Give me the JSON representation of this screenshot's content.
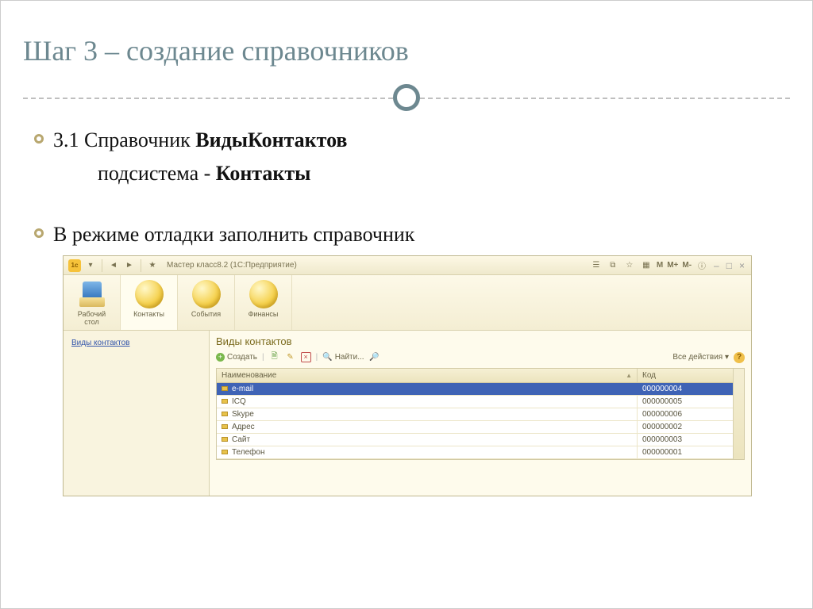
{
  "slide": {
    "title": "Шаг 3 – создание справочников",
    "b1_prefix": "3.1 Справочник  ",
    "b1_bold": "ВидыКонтактов",
    "b2_prefix": "подсистема -  ",
    "b2_bold": "Контакты",
    "b3": "В режиме отладки заполнить  справочник"
  },
  "app": {
    "title": "Мастер класс8.2  (1С:Предприятие)",
    "right_labels": [
      "М",
      "М+",
      "М-"
    ],
    "nav": [
      {
        "label": "Рабочий\nстол"
      },
      {
        "label": "Контакты"
      },
      {
        "label": "События"
      },
      {
        "label": "Финансы"
      }
    ],
    "side_link": "Виды контактов",
    "panel_title": "Виды контактов",
    "toolbar": {
      "create": "Создать",
      "find": "Найти...",
      "actions": "Все действия ▾"
    },
    "grid": {
      "col_name": "Наименование",
      "col_code": "Код",
      "rows": [
        {
          "name": "e-mail",
          "code": "000000004",
          "selected": true
        },
        {
          "name": "ICQ",
          "code": "000000005"
        },
        {
          "name": "Skype",
          "code": "000000006"
        },
        {
          "name": "Адрес",
          "code": "000000002"
        },
        {
          "name": "Сайт",
          "code": "000000003"
        },
        {
          "name": "Телефон",
          "code": "000000001"
        }
      ]
    }
  }
}
